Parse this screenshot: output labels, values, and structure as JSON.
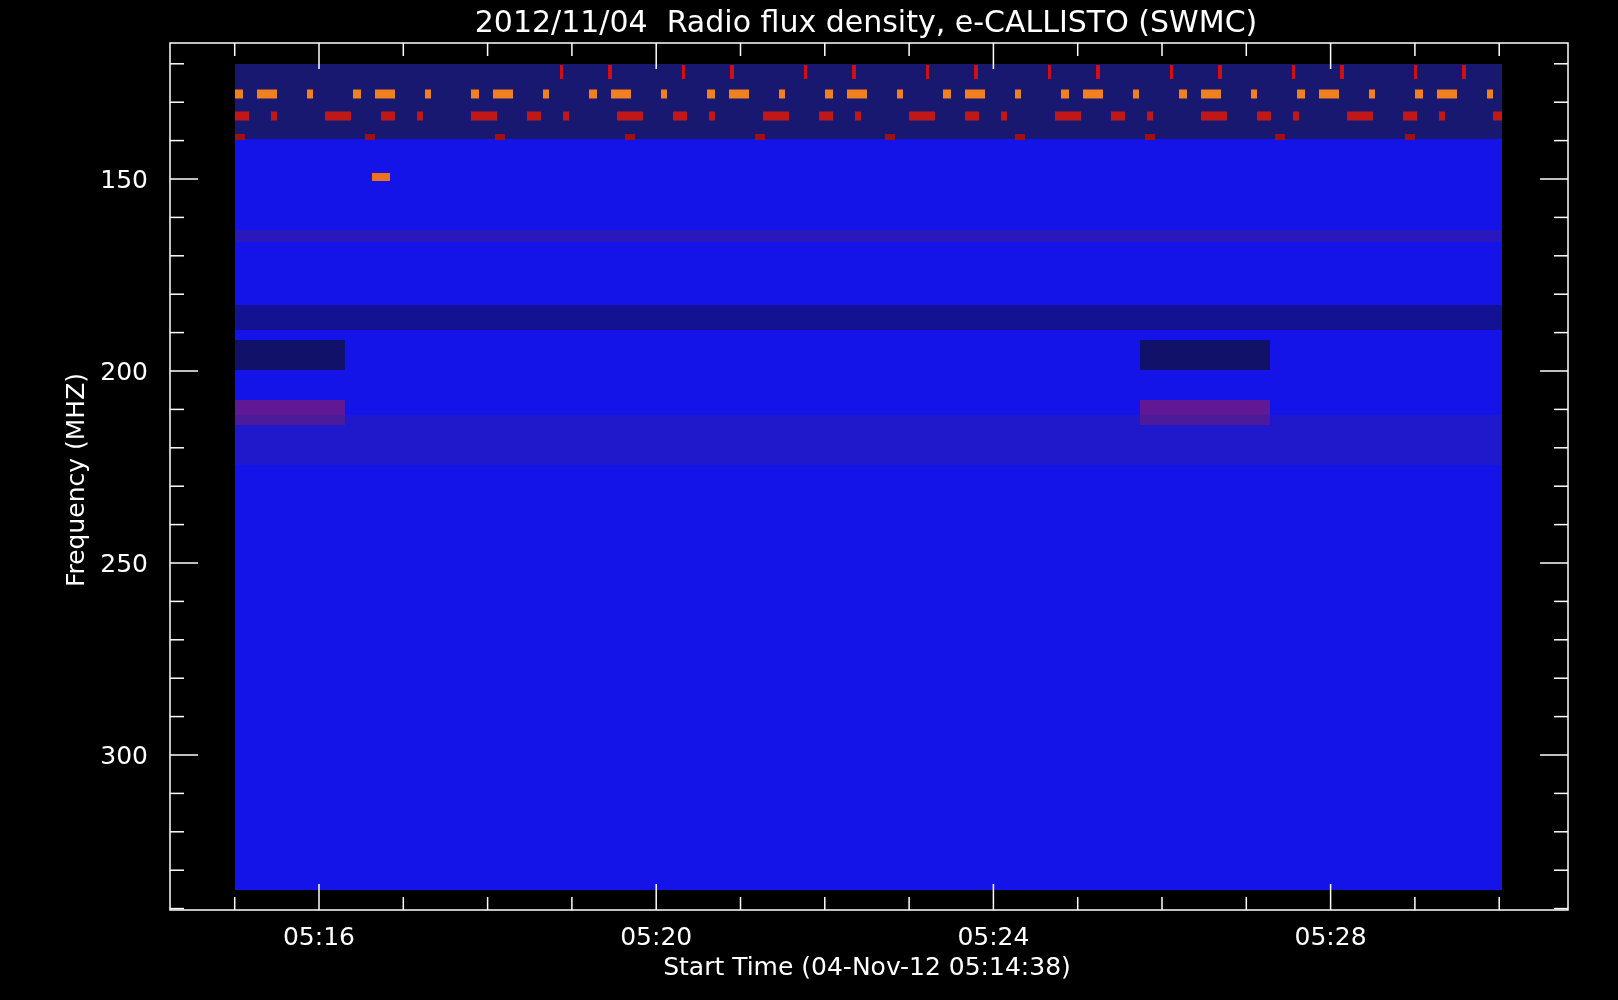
{
  "title": "2012/11/04  Radio flux density, e-CALLISTO (SWMC)",
  "y_axis": {
    "label": "Frequency (MHZ)",
    "ticks": [
      "150",
      "200",
      "250",
      "300"
    ]
  },
  "x_axis": {
    "label": "Start Time (04-Nov-12 05:14:38)",
    "ticks": [
      "05:16",
      "05:20",
      "05:24",
      "05:28"
    ]
  }
}
